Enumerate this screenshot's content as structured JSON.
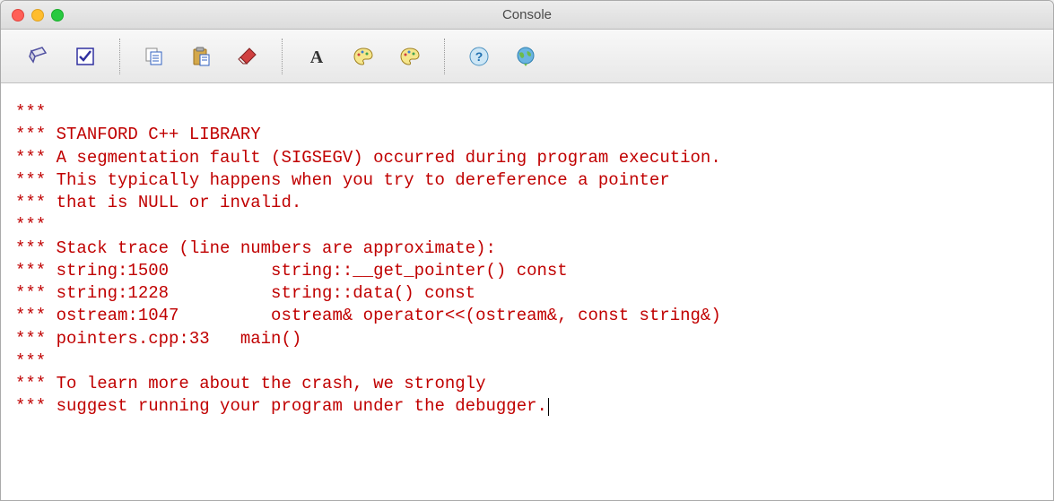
{
  "window": {
    "title": "Console"
  },
  "toolbar": {
    "icons": {
      "save": "save-icon",
      "check": "check-icon",
      "copy": "copy-icon",
      "paste": "paste-icon",
      "eraser": "eraser-icon",
      "font": "font-icon",
      "bgcolor": "palette-icon",
      "fgcolor": "palette-icon",
      "help": "help-icon",
      "about": "globe-icon"
    }
  },
  "console": {
    "lines": [
      "***",
      "*** STANFORD C++ LIBRARY",
      "*** A segmentation fault (SIGSEGV) occurred during program execution.",
      "*** This typically happens when you try to dereference a pointer",
      "*** that is NULL or invalid.",
      "***",
      "*** Stack trace (line numbers are approximate):",
      "*** string:1500          string::__get_pointer() const",
      "*** string:1228          string::data() const",
      "*** ostream:1047         ostream& operator<<(ostream&, const string&)",
      "*** pointers.cpp:33   main()",
      "***",
      "*** To learn more about the crash, we strongly",
      "*** suggest running your program under the debugger."
    ]
  },
  "colors": {
    "error_text": "#c00000",
    "titlebar_bg_top": "#ececec",
    "titlebar_bg_bottom": "#dcdcdc"
  }
}
